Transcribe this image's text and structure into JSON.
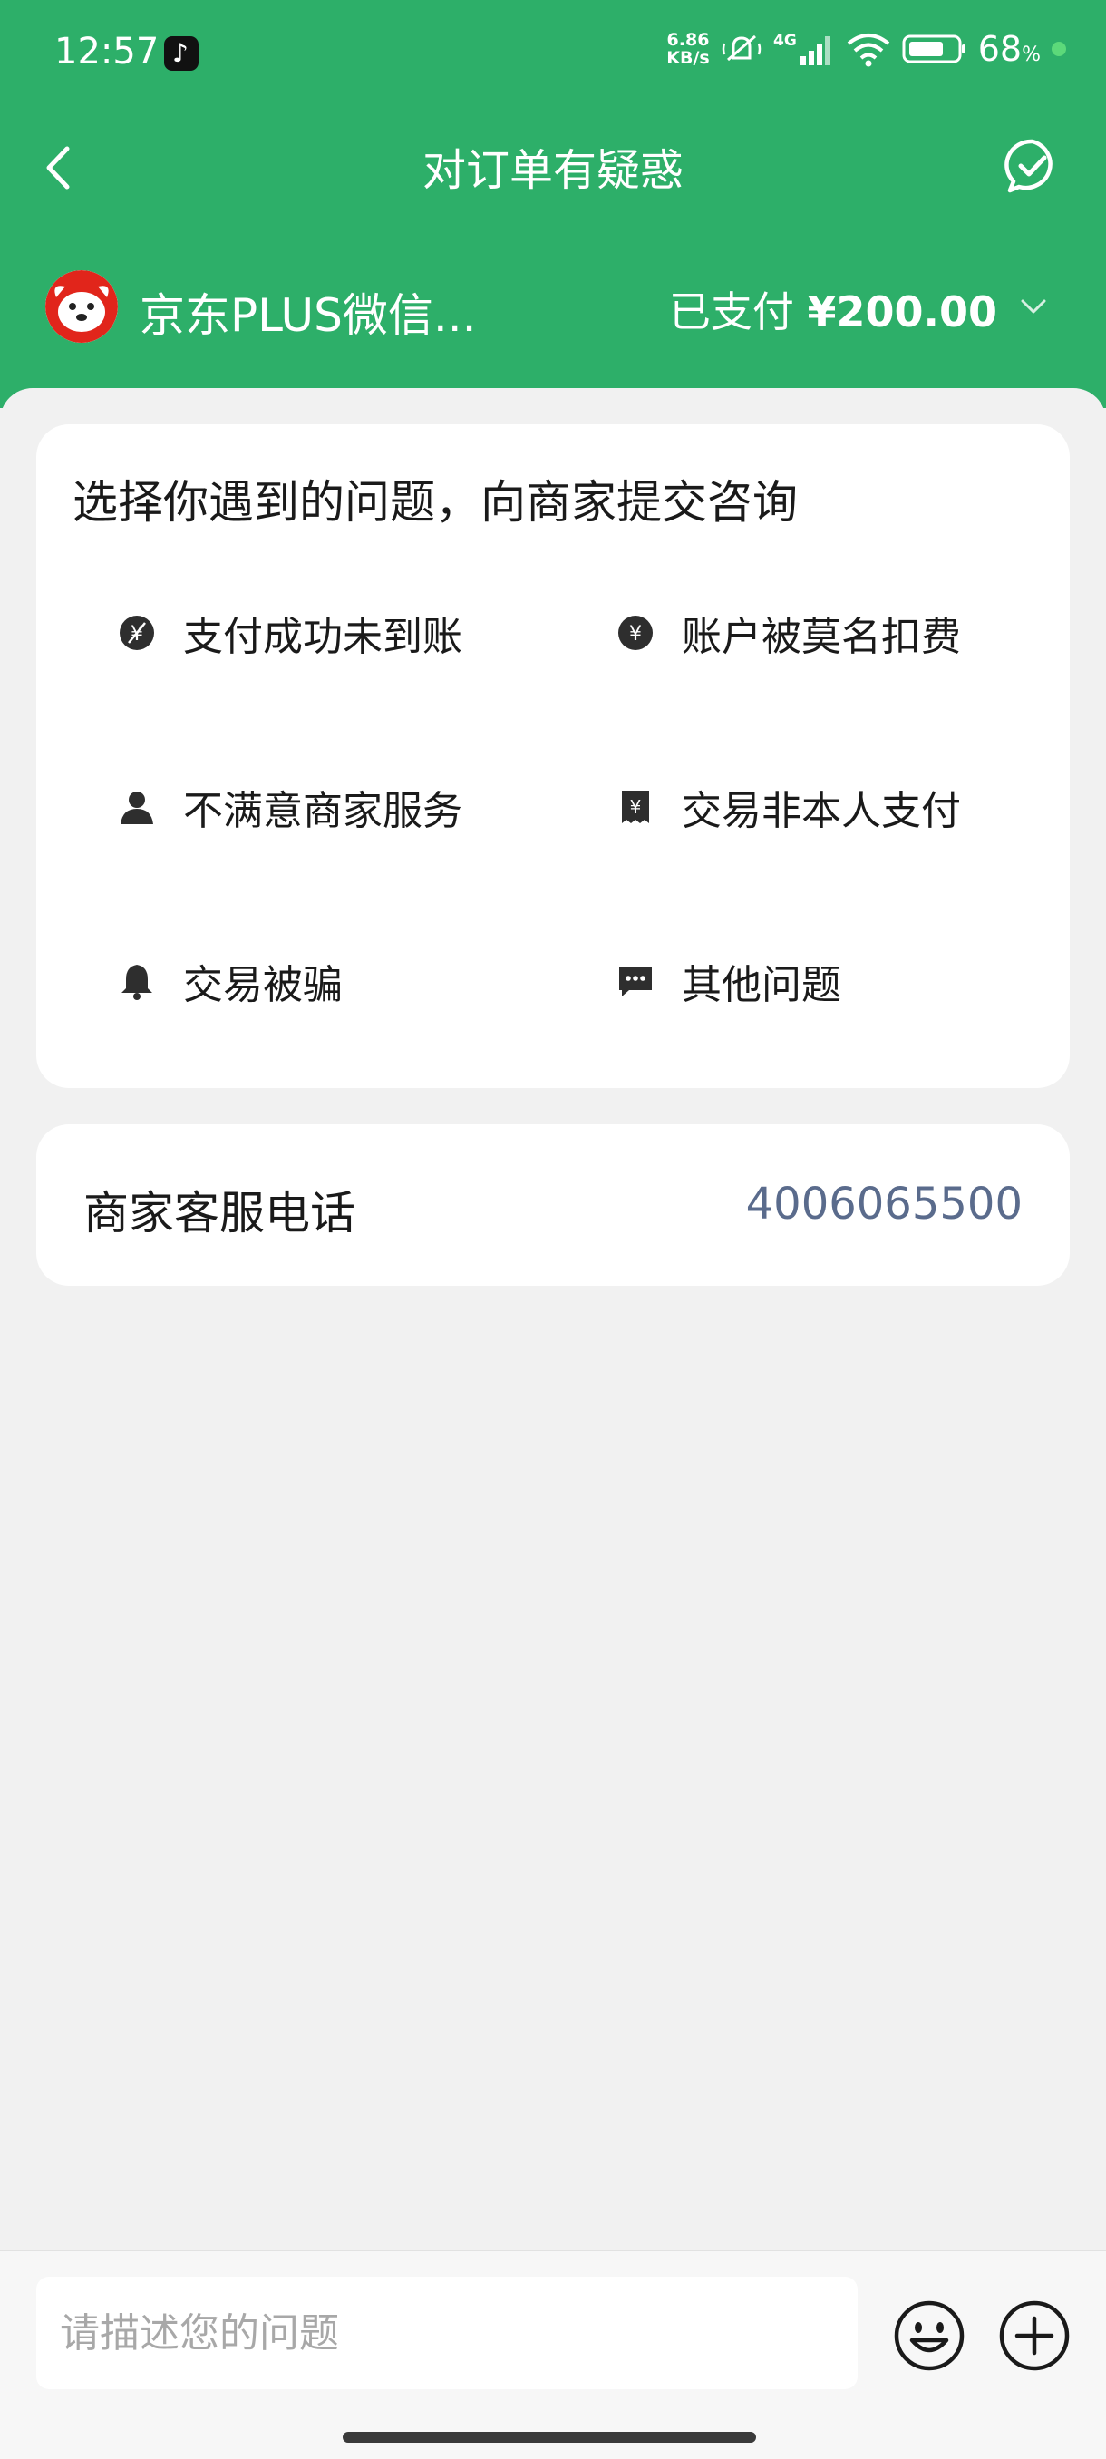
{
  "status_bar": {
    "time": "12:57",
    "net_speed_value": "6.86",
    "net_speed_unit": "KB/s",
    "network": "4G",
    "battery": "68",
    "battery_unit": "%"
  },
  "nav": {
    "title": "对订单有疑惑"
  },
  "merchant": {
    "name": "京东PLUS微信...",
    "paid_label": "已支付",
    "amount": "¥200.00"
  },
  "issues": {
    "heading": "选择你遇到的问题，向商家提交咨询",
    "items": [
      {
        "label": "支付成功未到账",
        "icon": "payment-not-received-icon"
      },
      {
        "label": "账户被莫名扣费",
        "icon": "yuan-coin-icon"
      },
      {
        "label": "不满意商家服务",
        "icon": "person-icon"
      },
      {
        "label": "交易非本人支付",
        "icon": "ticket-yuan-icon"
      },
      {
        "label": "交易被骗",
        "icon": "bell-icon"
      },
      {
        "label": "其他问题",
        "icon": "chat-bubble-icon"
      }
    ]
  },
  "phone": {
    "label": "商家客服电话",
    "number": "4006065500"
  },
  "composer": {
    "placeholder": "请描述您的问题"
  }
}
